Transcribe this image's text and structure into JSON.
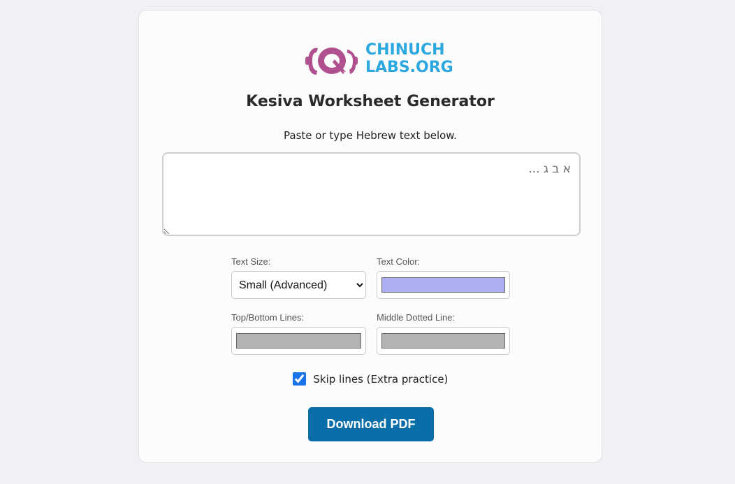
{
  "logo": {
    "line1": "CHINUCH",
    "line2": "LABS.ORG",
    "icon_color": "#b0508f",
    "text_color": "#2ba8e0"
  },
  "title": "Kesiva Worksheet Generator",
  "subtitle": "Paste or type Hebrew text below.",
  "editor": {
    "placeholder": "א ב ג ...",
    "value": ""
  },
  "controls": {
    "text_size": {
      "label": "Text Size:",
      "selected": "Small (Advanced)"
    },
    "text_color": {
      "label": "Text Color:",
      "value": "#aeaef5"
    },
    "top_bottom_lines": {
      "label": "Top/Bottom Lines:",
      "value": "#b3b3b3"
    },
    "middle_dotted_line": {
      "label": "Middle Dotted Line:",
      "value": "#b3b3b3"
    }
  },
  "skip_lines": {
    "label": "Skip lines (Extra practice)",
    "checked": true
  },
  "download_label": "Download PDF",
  "colors": {
    "page_bg": "#f0f1f5",
    "card_bg": "#fcfcfc",
    "button_bg": "#0a6ea8"
  }
}
